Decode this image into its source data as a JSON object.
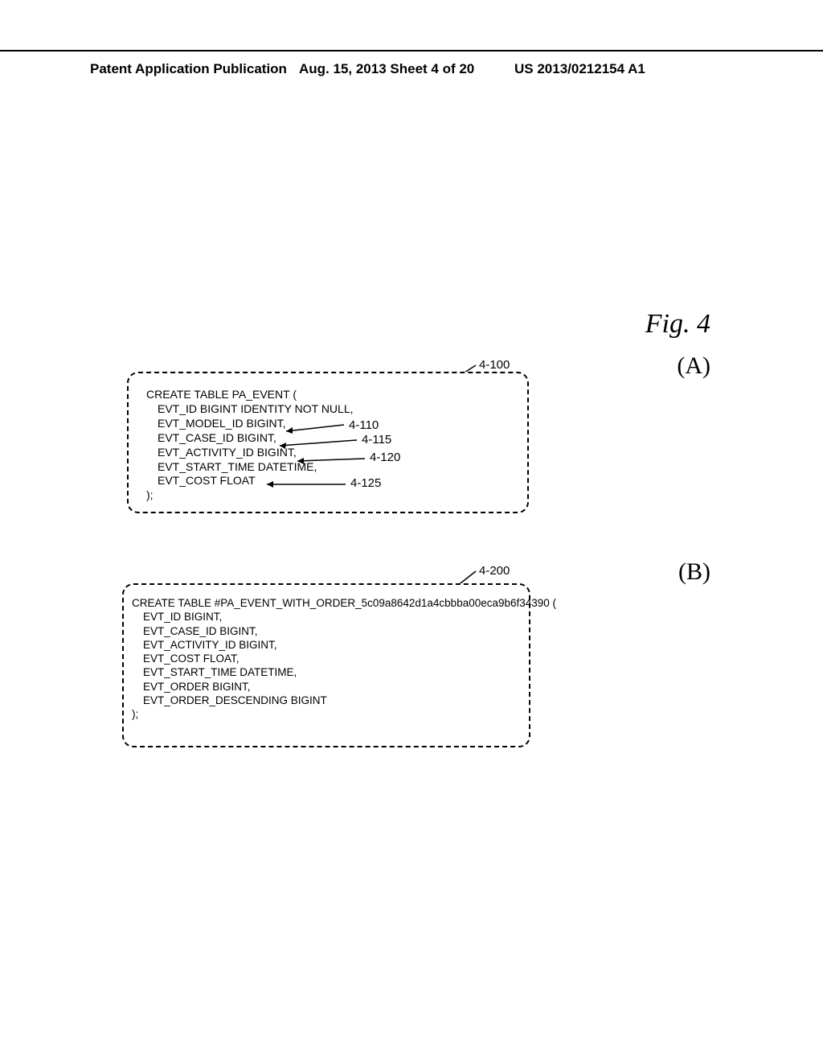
{
  "header": {
    "left": "Patent Application Publication",
    "center": "Aug. 15, 2013  Sheet 4 of 20",
    "right": "US 2013/0212154 A1"
  },
  "figure_label": "Fig. 4",
  "panels": {
    "a_label": "(A)",
    "b_label": "(B)"
  },
  "refs": {
    "r4100": "4-100",
    "r4200": "4-200",
    "r4110": "4-110",
    "r4115": "4-115",
    "r4120": "4-120",
    "r4125": "4-125"
  },
  "codeA": {
    "l1": "CREATE TABLE PA_EVENT (",
    "l2": "EVT_ID BIGINT IDENTITY NOT NULL,",
    "l3": "EVT_MODEL_ID BIGINT,",
    "l4": "EVT_CASE_ID BIGINT,",
    "l5": "EVT_ACTIVITY_ID BIGINT,",
    "l6": "EVT_START_TIME DATETIME,",
    "l7": "EVT_COST FLOAT",
    "l8": ");"
  },
  "codeB": {
    "l1": "CREATE TABLE #PA_EVENT_WITH_ORDER_5c09a8642d1a4cbbba00eca9b6f34390 (",
    "l2": "EVT_ID BIGINT,",
    "l3": "EVT_CASE_ID BIGINT,",
    "l4": "EVT_ACTIVITY_ID BIGINT,",
    "l5": "EVT_COST FLOAT,",
    "l6": "EVT_START_TIME DATETIME,",
    "l7": "EVT_ORDER BIGINT,",
    "l8": "EVT_ORDER_DESCENDING BIGINT",
    "l9": ");"
  }
}
